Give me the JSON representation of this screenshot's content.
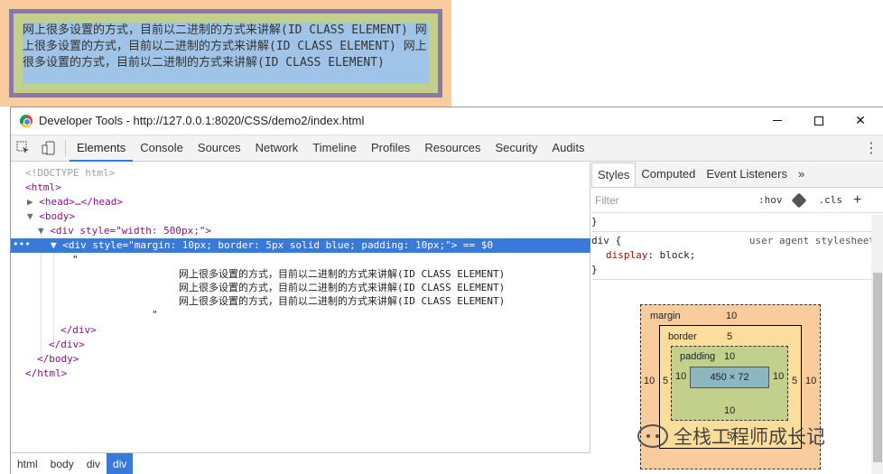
{
  "preview": {
    "text": "网上很多设置的方式，目前以二进制的方式来讲解(ID CLASS ELEMENT) 网上很多设置的方式，目前以二进制的方式来讲解(ID CLASS ELEMENT) 网上很多设置的方式，目前以二进制的方式来讲解(ID CLASS ELEMENT)"
  },
  "window": {
    "title": "Developer Tools - http://127.0.0.1:8020/CSS/demo2/index.html"
  },
  "toolbar": {
    "tabs": [
      "Elements",
      "Console",
      "Sources",
      "Network",
      "Timeline",
      "Profiles",
      "Resources",
      "Security",
      "Audits"
    ]
  },
  "dom": {
    "doctype": "<!DOCTYPE html>",
    "html_open": "<html>",
    "head": "<head>…</head>",
    "body_open": "<body>",
    "div_outer_open": "<div style=\"width: 500px;\">",
    "div_selected": "<div style=\"margin: 10px; border: 5px solid blue; padding: 10px;\"> == $0",
    "quote_open": "\"",
    "text_line_1": "网上很多设置的方式，目前以二进制的方式来讲解(ID CLASS ELEMENT)",
    "text_line_2": "网上很多设置的方式，目前以二进制的方式来讲解(ID CLASS ELEMENT)",
    "text_line_3": "网上很多设置的方式，目前以二进制的方式来讲解(ID CLASS ELEMENT)",
    "quote_close": "\"",
    "div_close_inner": "</div>",
    "div_close_outer": "</div>",
    "body_close": "</body>",
    "html_close": "</html>"
  },
  "breadcrumbs": [
    "html",
    "body",
    "div",
    "div"
  ],
  "styles": {
    "tabs": [
      "Styles",
      "Computed",
      "Event Listeners",
      "»"
    ],
    "filter_placeholder": "Filter",
    "hov": ":hov",
    "cls": ".cls",
    "plus": "+",
    "brace_close_prev": "}",
    "selector": "div {",
    "source": "user agent stylesheet",
    "prop_name": "display",
    "prop_value": ": block;",
    "brace_close": "}"
  },
  "box_model": {
    "margin_label": "margin",
    "margin_top": "10",
    "margin_left": "10",
    "margin_right": "10",
    "border_label": "border",
    "border_top": "5",
    "border_left": "5",
    "border_right": "5",
    "border_bottom": "5",
    "padding_label": "padding",
    "padding_top": "10",
    "padding_left": "10",
    "padding_right": "10",
    "padding_bottom": "10",
    "content": "450 × 72"
  },
  "watermark": "全栈工程师成长记"
}
